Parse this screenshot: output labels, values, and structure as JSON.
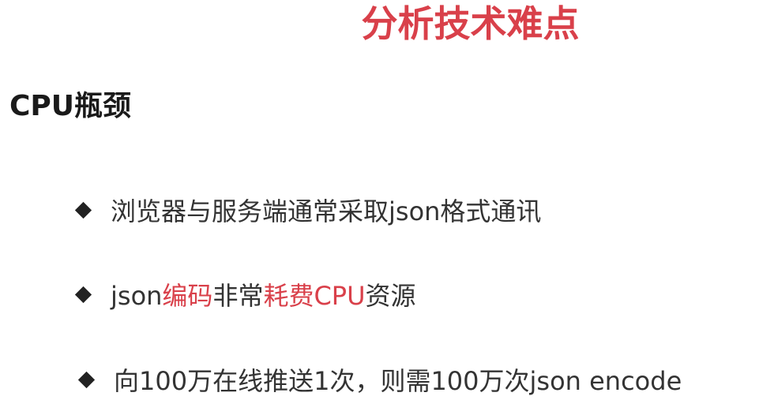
{
  "slide": {
    "title": "分析技术难点",
    "heading": "CPU瓶颈",
    "bullets": [
      {
        "text": "浏览器与服务端通常采取json格式通讯"
      },
      {
        "parts": [
          {
            "text": "json"
          },
          {
            "text": "编码"
          },
          {
            "text": "非常"
          },
          {
            "text": "耗费CPU"
          },
          {
            "text": "资源"
          }
        ]
      },
      {
        "text": "向100万在线推送1次，则需100万次json encode"
      }
    ]
  },
  "colors": {
    "accent": "#d9404a",
    "text": "#333333",
    "heading": "#1a1a1a"
  },
  "icons": {
    "bullet": "diamond-bullet-icon"
  }
}
